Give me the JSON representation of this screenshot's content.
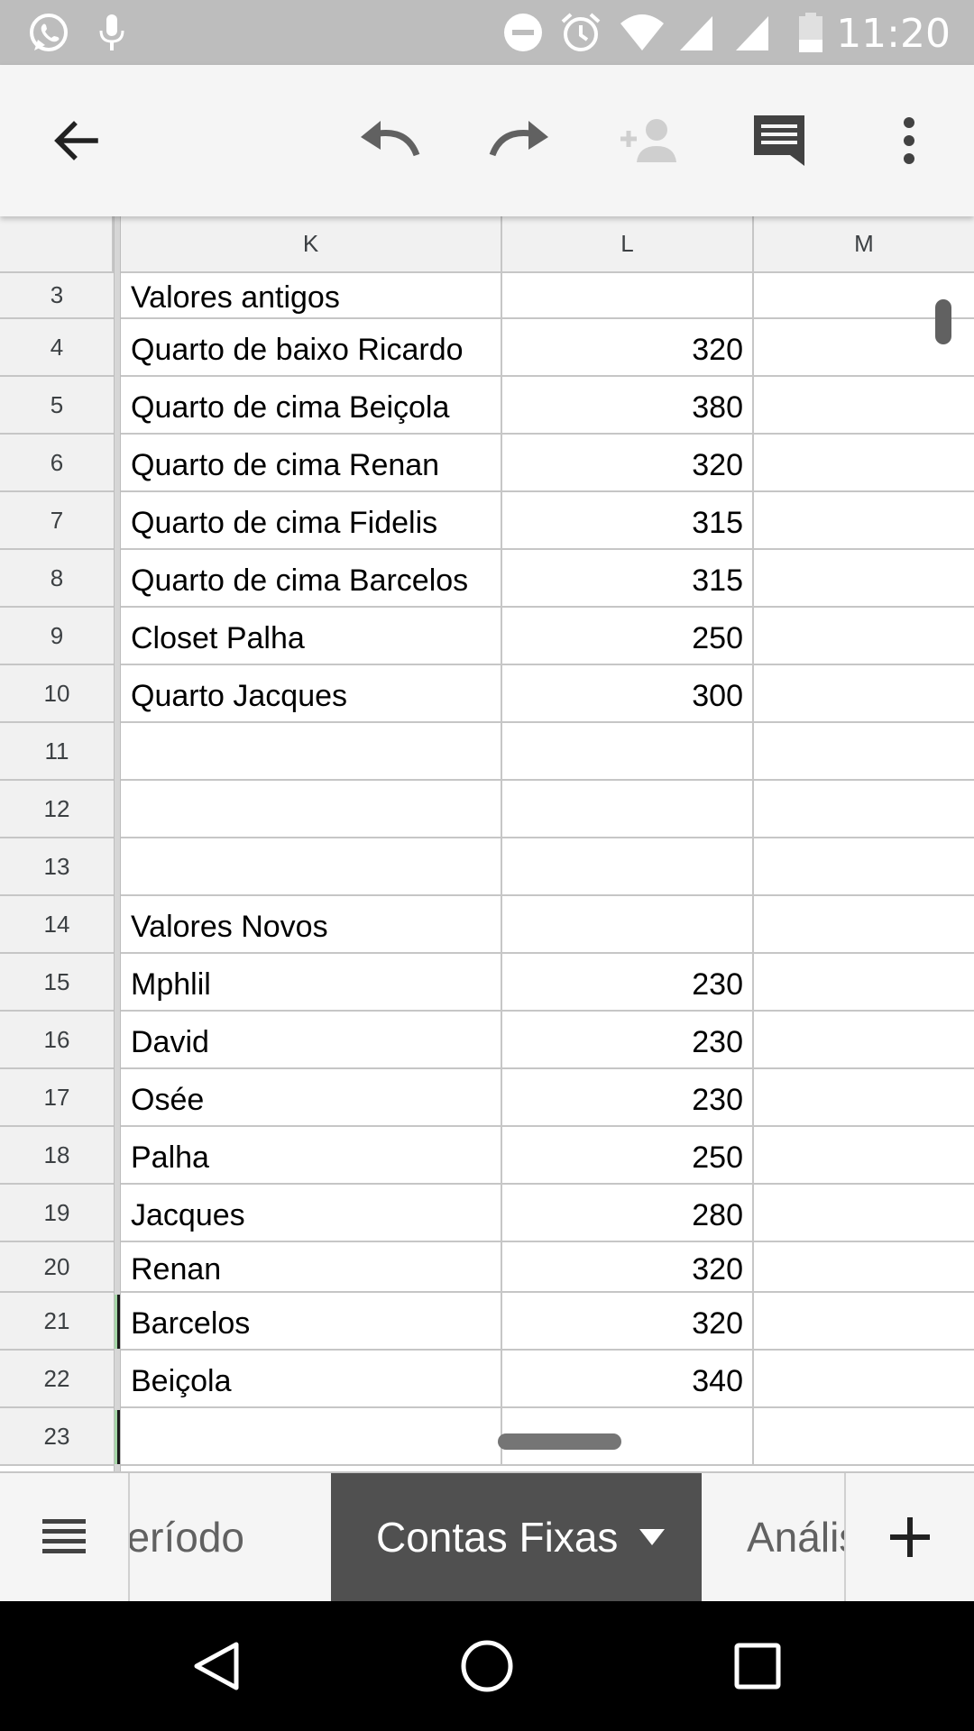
{
  "status_bar": {
    "time": "11:20",
    "icons": [
      "whatsapp-icon",
      "mic-icon",
      "do-not-disturb-icon",
      "alarm-icon",
      "wifi-icon",
      "signal-icon",
      "signal-icon",
      "battery-icon"
    ]
  },
  "toolbar": {
    "icons": [
      "back-arrow-icon",
      "undo-icon",
      "redo-icon",
      "add-person-icon",
      "comment-icon",
      "more-vert-icon"
    ]
  },
  "columns": [
    "K",
    "L",
    "M"
  ],
  "rows": [
    {
      "num": "3",
      "k": "Valores antigos",
      "l": ""
    },
    {
      "num": "4",
      "k": "Quarto de baixo Ricardo",
      "l": "320"
    },
    {
      "num": "5",
      "k": "Quarto de cima Beiçola",
      "l": "380"
    },
    {
      "num": "6",
      "k": "Quarto de cima Renan",
      "l": "320"
    },
    {
      "num": "7",
      "k": "Quarto de cima Fidelis",
      "l": "315"
    },
    {
      "num": "8",
      "k": "Quarto de cima Barcelos",
      "l": "315"
    },
    {
      "num": "9",
      "k": "Closet Palha",
      "l": "250"
    },
    {
      "num": "10",
      "k": "Quarto Jacques",
      "l": "300"
    },
    {
      "num": "11",
      "k": "",
      "l": ""
    },
    {
      "num": "12",
      "k": "",
      "l": ""
    },
    {
      "num": "13",
      "k": "",
      "l": ""
    },
    {
      "num": "14",
      "k": "Valores Novos",
      "l": ""
    },
    {
      "num": "15",
      "k": "Mphlil",
      "l": "230"
    },
    {
      "num": "16",
      "k": "David",
      "l": "230"
    },
    {
      "num": "17",
      "k": "Osée",
      "l": "230"
    },
    {
      "num": "18",
      "k": "Palha",
      "l": "250"
    },
    {
      "num": "19",
      "k": "Jacques",
      "l": "280"
    },
    {
      "num": "20",
      "k": "Renan",
      "l": "320"
    },
    {
      "num": "21",
      "k": "Barcelos",
      "l": "320"
    },
    {
      "num": "22",
      "k": "Beiçola",
      "l": "340"
    },
    {
      "num": "23",
      "k": "",
      "l": ""
    }
  ],
  "sheet_tabs": {
    "previous": "Período",
    "active": "Contas Fixas",
    "next": "Análise"
  },
  "nav_bar": {
    "icons": [
      "back-triangle-icon",
      "home-circle-icon",
      "recents-square-icon"
    ]
  },
  "colors": {
    "status_bar": "#bdbdbd",
    "toolbar": "#f5f5f5",
    "active_tab": "#505050",
    "selection_marker": "#a5d6a7"
  }
}
